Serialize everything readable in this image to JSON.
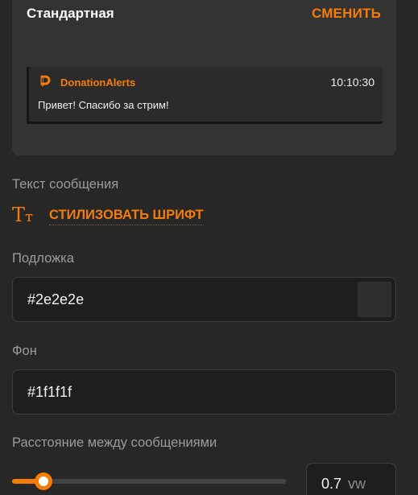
{
  "card": {
    "title": "Стандартная",
    "change_label": "СМЕНИТЬ",
    "preview": {
      "icon": "donationalerts-logo-icon",
      "sender": "DonationAlerts",
      "time": "10:10:30",
      "message": "Привет! Спасибо за стрим!"
    }
  },
  "message_text": {
    "label": "Текст сообщения",
    "style_icon": "font-style-icon",
    "style_icon_text": "Tт",
    "stylize_label": "СТИЛИЗОВАТЬ ШРИФТ"
  },
  "backing": {
    "label": "Подложка",
    "value": "#2e2e2e",
    "swatch_color": "#2e2e2e"
  },
  "background": {
    "label": "Фон",
    "value": "#1f1f1f",
    "swatch_color": "#1f1f1f"
  },
  "spacing": {
    "label": "Расстояние между сообщениями",
    "value": "0.7",
    "unit": "vw",
    "slider_fraction": 0.115
  },
  "colors": {
    "accent": "#f57d07",
    "page_bg": "#272727",
    "card_bg": "#333333",
    "input_bg": "#1e1e1e"
  }
}
